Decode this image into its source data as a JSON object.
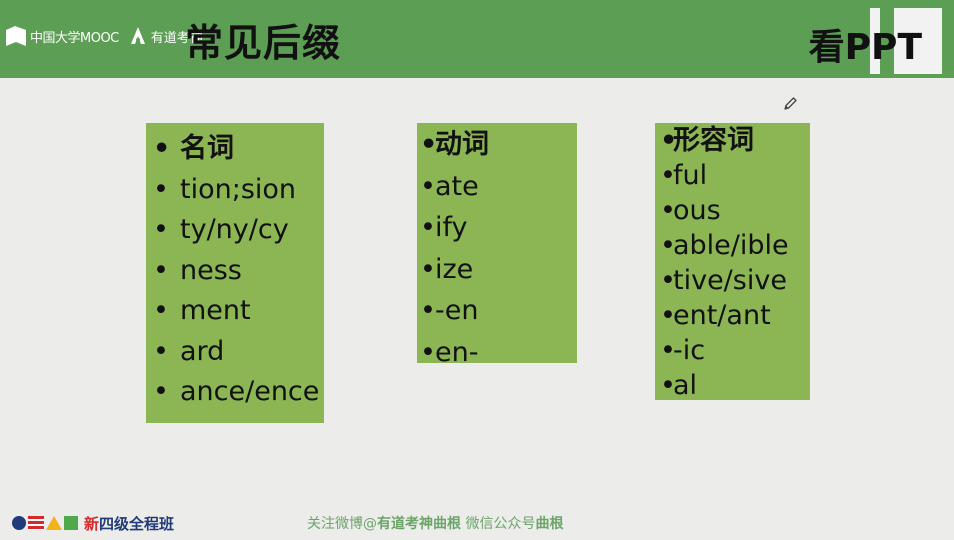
{
  "header": {
    "brand_mooc": "中国大学MOOC",
    "brand_youdao": "有道考神",
    "title": "常见后缀",
    "kan_ppt": "看PPT"
  },
  "colors": {
    "header_green": "#5d9e55",
    "box_green": "#8cb554",
    "footer_green": "#6ca56a"
  },
  "boxes": {
    "noun": {
      "heading": "名词",
      "items": [
        "tion;sion",
        "ty/ny/cy",
        "ness",
        "ment",
        "ard",
        "ance/ence"
      ]
    },
    "verb": {
      "heading": "动词",
      "items": [
        "ate",
        "ify",
        "ize",
        "-en",
        "en-"
      ]
    },
    "adj": {
      "heading": "形容词",
      "items": [
        "ful",
        "ous",
        "able/ible",
        "tive/sive",
        "ent/ant",
        "-ic",
        "al"
      ]
    }
  },
  "bullet": "•",
  "icons": [
    "pencil-icon",
    "mooc-logo-icon",
    "youdao-logo-icon",
    "course-logo-icon"
  ],
  "bottom": {
    "course_prefix": "新",
    "course_name": "四级全程班"
  },
  "footer": {
    "follow_weibo": "关注微博@",
    "weibo_account": "有道考神曲根",
    "wechat_label": "微信公众号",
    "wechat_account": "曲根"
  }
}
